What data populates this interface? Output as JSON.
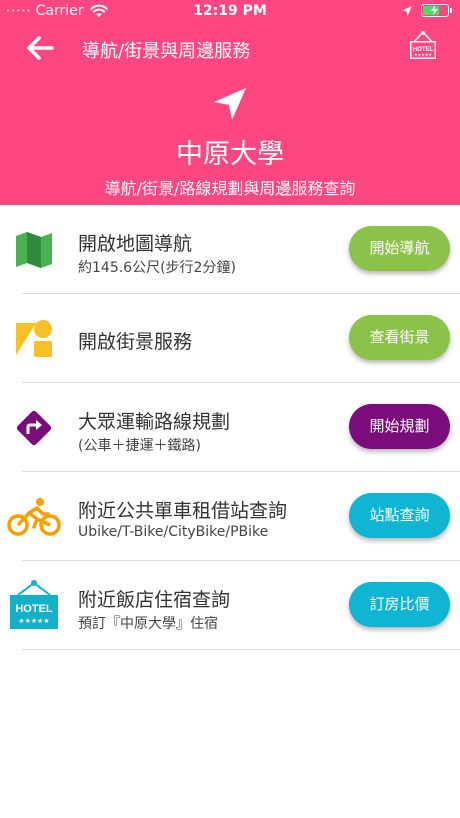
{
  "status_bar": {
    "signal": "•••••",
    "carrier": "Carrier",
    "time": "12:19 PM"
  },
  "nav": {
    "title": "導航/街景與周邊服務",
    "back_icon": "arrow-left-icon",
    "hotel_icon": "hotel-sign-icon",
    "hotel_icon_text": "HOTEL"
  },
  "hero": {
    "icon": "navigation-arrow-icon",
    "title": "中原大學",
    "subtitle": "導航/街景/路線規劃與周邊服務查詢"
  },
  "colors": {
    "header": "#fe4680",
    "green": "#8bc34a",
    "purple": "#7b0c7c",
    "cyan": "#0fb5d3"
  },
  "rows": [
    {
      "icon": "map-icon",
      "title": "開啟地圖導航",
      "subtitle": "約145.6公尺(步行2分鐘)",
      "button": "開始導航",
      "button_color": "#8bc34a"
    },
    {
      "icon": "street-view-icon",
      "title": "開啟街景服務",
      "subtitle": "",
      "button": "查看街景",
      "button_color": "#8bc34a"
    },
    {
      "icon": "directions-icon",
      "title": "大眾運輸路線規劃",
      "subtitle": "(公車＋捷運＋鐵路)",
      "button": "開始規劃",
      "button_color": "#7b0c7c"
    },
    {
      "icon": "bicycle-icon",
      "title": "附近公共單車租借站查詢",
      "subtitle": "Ubike/T-Bike/CityBike/PBike",
      "button": "站點查詢",
      "button_color": "#0fb5d3"
    },
    {
      "icon": "hotel-icon",
      "title": "附近飯店住宿查詢",
      "subtitle": "預訂『中原大學』住宿",
      "button": "訂房比價",
      "button_color": "#0fb5d3",
      "icon_text": "HOTEL"
    }
  ]
}
